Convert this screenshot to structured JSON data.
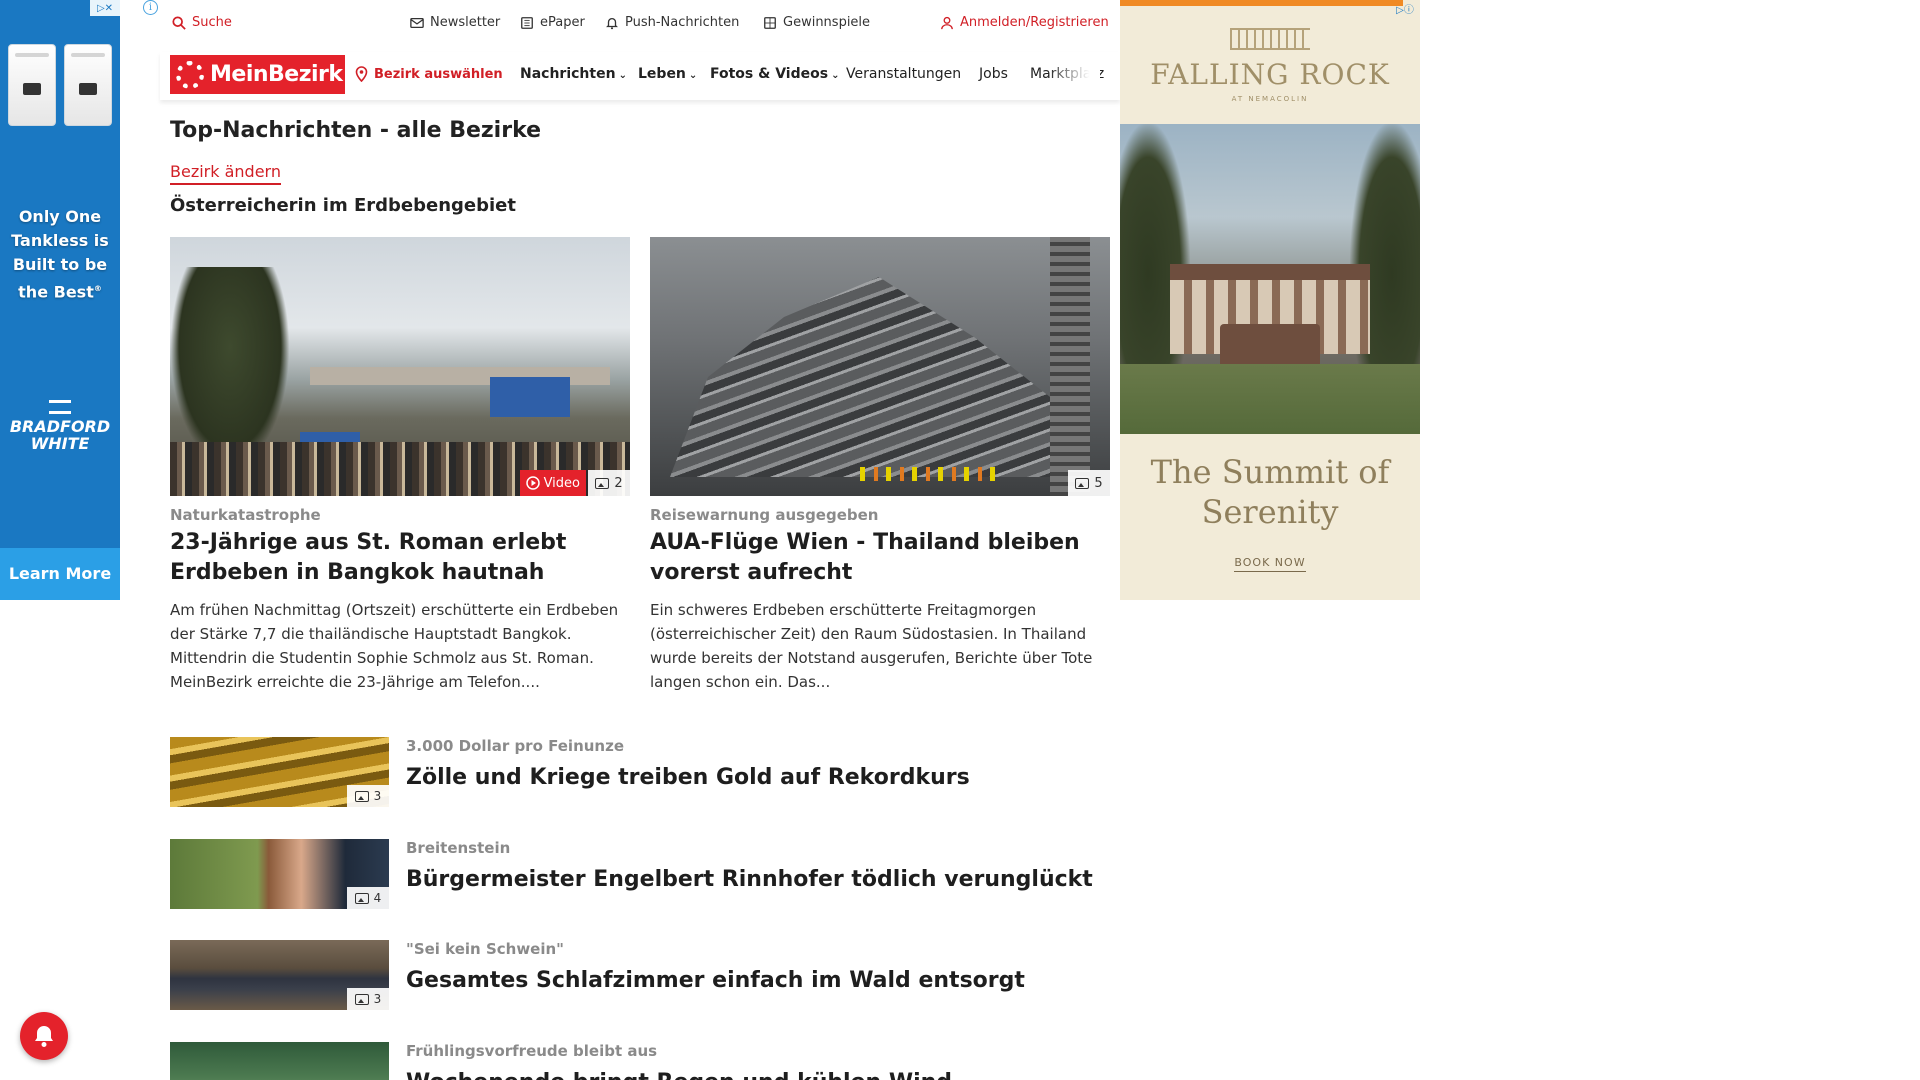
{
  "left_ad": {
    "tagline": "Only One Tankless is Built to be the Best",
    "trademark": "®",
    "brand": "BRADFORD WHITE",
    "cta": "Learn More"
  },
  "utility": {
    "search": "Suche",
    "newsletter": "Newsletter",
    "epaper": "ePaper",
    "push": "Push-Nachrichten",
    "contests": "Gewinnspiele",
    "login": "Anmelden/Registrieren"
  },
  "nav": {
    "logo": "MeinBezirk",
    "select_district": "Bezirk auswählen",
    "items": [
      "Nachrichten",
      "Leben",
      "Fotos & Videos",
      "Veranstaltungen",
      "Jobs",
      "Marktplatz"
    ]
  },
  "page": {
    "title": "Top-Nachrichten - alle Bezirke",
    "change_district": "Bezirk ändern",
    "topic": "Österreicherin im Erdbebengebiet"
  },
  "lead_articles": [
    {
      "kicker": "Naturkatastrophe",
      "headline": "23-Jährige aus St. Roman erlebt Erdbeben in Bangkok hautnah",
      "teaser": "Am frühen Nachmittag (Ortszeit) erschütterte ein Erdbeben der Stärke 7,7 die thailändische Hauptstadt Bangkok. Mittendrin die Studentin Sophie Schmolz aus St. Roman. MeinBezirk erreichte die 23-Jährige am Telefon....",
      "video_label": "Video",
      "image_count": "2"
    },
    {
      "kicker": "Reisewarnung ausgegeben",
      "headline": "AUA-Flüge Wien - Thailand bleiben vorerst aufrecht",
      "teaser": "Ein schweres Erdbeben erschütterte Freitagmorgen (österreichischer Zeit) den Raum Südostasien. In Thailand wurde bereits der Notstand ausgerufen, Berichte über Tote langen schon ein. Das...",
      "image_count": "5"
    }
  ],
  "list_articles": [
    {
      "kicker": "3.000 Dollar pro Feinunze",
      "title": "Zölle und Kriege treiben Gold auf Rekordkurs",
      "image_count": "3"
    },
    {
      "kicker": "Breitenstein",
      "title": "Bürgermeister Engelbert Rinnhofer tödlich verunglückt",
      "image_count": "4"
    },
    {
      "kicker": "\"Sei kein Schwein\"",
      "title": "Gesamtes Schlafzimmer einfach im Wald entsorgt",
      "image_count": "3"
    },
    {
      "kicker": "Frühlingsvorfreude bleibt aus",
      "title": "Wochenende bringt Regen und kühlen Wind"
    }
  ],
  "right_ad": {
    "brand": "FALLING ROCK",
    "brand_sub": "AT NEMACOLIN",
    "slogan": "The Summit of Serenity",
    "cta": "BOOK NOW"
  },
  "colors": {
    "brand_red": "#e4222b",
    "ad_blue": "#1a78c2"
  }
}
